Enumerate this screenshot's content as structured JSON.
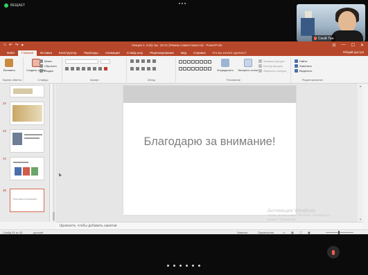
{
  "overlay": {
    "status_label": "ВЕЩАЕТ",
    "cam_name": "Сюэй Тан",
    "page_dots": 6
  },
  "ppt": {
    "quick_access": [
      "⌂",
      "↶",
      "↷",
      "▾"
    ],
    "doc_title": "Лекция 1. 6.9(с вы. 19-21 (Режим совместимости) - PowerPoint",
    "window_controls": [
      "⊡",
      "—",
      "☐",
      "✕"
    ],
    "tabs": [
      "Файл",
      "Главная",
      "Вставка",
      "Конструктор",
      "Переходы",
      "Анимация",
      "Слайд-шоу",
      "Рецензирование",
      "Вид",
      "Справка"
    ],
    "tell_me": "Что вы хотите сделать?",
    "share": "Общий доступ",
    "ribbon": {
      "paste": "Вставить",
      "new_slide": "Создать слайд",
      "layout": "Макет",
      "reset": "Сбросить",
      "section": "Раздел",
      "font_group": "Шрифт",
      "paragraph_group": "Абзац",
      "clipboard_group": "Буфер обмена",
      "slides_group": "Слайды",
      "drawing_group": "Рисование",
      "arrange": "Упорядочить",
      "quick_styles": "Экспресс-стили",
      "shape_fill": "Заливка фигуры",
      "shape_outline": "Контур фигуры",
      "shape_effects": "Эффекты фигуры",
      "find": "Найти",
      "replace": "Заменить",
      "select": "Выделить",
      "editing_group": "Редактирование"
    },
    "thumbnails": [
      {
        "num": "",
        "caption": ""
      },
      {
        "num": "32",
        "caption": ""
      },
      {
        "num": "33",
        "caption": ""
      },
      {
        "num": "34",
        "caption": ""
      },
      {
        "num": "35",
        "caption": "Благодарю за внимание!"
      }
    ],
    "slide": {
      "header_line1": "",
      "header_line2": "",
      "title": "Благодарю за внимание!"
    },
    "notes_placeholder": "Щелкните, чтобы добавить заметки",
    "status": {
      "slide_info": "Слайд 35 из 35",
      "language": "русский",
      "notes_btn": "Заметки",
      "comments_btn": "Примечания"
    },
    "activation": {
      "title": "Активация Windows",
      "text": "Чтобы активировать Windows, перейдите в раздел \"Параметры\"."
    }
  },
  "colors": {
    "ppt_accent": "#b7472a",
    "selected_thumb": "#d2694f"
  }
}
